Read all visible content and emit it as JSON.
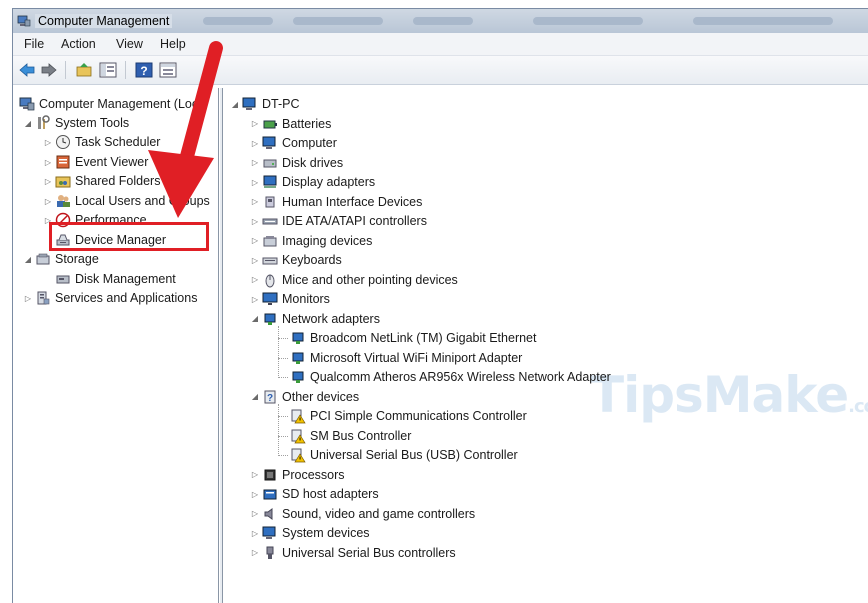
{
  "window": {
    "title": "Computer Management"
  },
  "menu": [
    "File",
    "Action",
    "View",
    "Help"
  ],
  "left_tree": {
    "root": "Computer Management (Local",
    "items": [
      {
        "label": "System Tools"
      },
      {
        "label": "Task Scheduler"
      },
      {
        "label": "Event Viewer"
      },
      {
        "label": "Shared Folders"
      },
      {
        "label": "Local Users and Groups"
      },
      {
        "label": "Performance"
      },
      {
        "label": "Device Manager"
      },
      {
        "label": "Storage"
      },
      {
        "label": "Disk Management"
      },
      {
        "label": "Services and Applications"
      }
    ]
  },
  "right_tree": {
    "root": "DT-PC",
    "categories": [
      {
        "label": "Batteries"
      },
      {
        "label": "Computer"
      },
      {
        "label": "Disk drives"
      },
      {
        "label": "Display adapters"
      },
      {
        "label": "Human Interface Devices"
      },
      {
        "label": "IDE ATA/ATAPI controllers"
      },
      {
        "label": "Imaging devices"
      },
      {
        "label": "Keyboards"
      },
      {
        "label": "Mice and other pointing devices"
      },
      {
        "label": "Monitors"
      },
      {
        "label": "Network adapters",
        "children": [
          "Broadcom NetLink (TM) Gigabit Ethernet",
          "Microsoft Virtual WiFi Miniport Adapter",
          "Qualcomm Atheros AR956x Wireless Network Adapter"
        ]
      },
      {
        "label": "Other devices",
        "children": [
          "PCI Simple Communications Controller",
          "SM Bus Controller",
          "Universal Serial Bus (USB) Controller"
        ]
      },
      {
        "label": "Processors"
      },
      {
        "label": "SD host adapters"
      },
      {
        "label": "Sound, video and game controllers"
      },
      {
        "label": "System devices"
      },
      {
        "label": "Universal Serial Bus controllers"
      }
    ]
  },
  "watermark": {
    "main": "TipsMake",
    "suffix": ".com"
  },
  "colors": {
    "highlight": "#e01f25",
    "arrow": "#e01f25",
    "warning": "#f2c200"
  }
}
